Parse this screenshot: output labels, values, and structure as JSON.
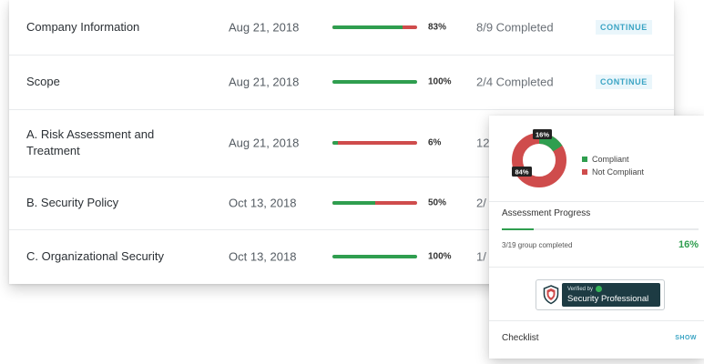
{
  "colors": {
    "complete_green": "#2f9e4f",
    "incomplete_red": "#cf4c4c",
    "continue_blue": "#3aa4c4",
    "badge_dark": "#1d3b43"
  },
  "table": {
    "rows": [
      {
        "name": "Company Information",
        "date": "Aug 21, 2018",
        "progress": 0.83,
        "pct": "83%",
        "completed": "8/9 Completed",
        "action": "CONTINUE"
      },
      {
        "name": "Scope",
        "date": "Aug 21, 2018",
        "progress": 1.0,
        "pct": "100%",
        "completed": "2/4 Completed",
        "action": "CONTINUE"
      },
      {
        "name": "A. Risk Assessment and Treatment",
        "date": "Aug 21, 2018",
        "progress": 0.06,
        "pct": "6%",
        "completed": "12",
        "action": ""
      },
      {
        "name": "B. Security Policy",
        "date": "Oct 13, 2018",
        "progress": 0.5,
        "pct": "50%",
        "completed": "2/",
        "action": ""
      },
      {
        "name": "C. Organizational Security",
        "date": "Oct 13, 2018",
        "progress": 1.0,
        "pct": "100%",
        "completed": "1/",
        "action": ""
      }
    ]
  },
  "panel": {
    "donut": {
      "compliant_fraction": 0.16,
      "compliant_label": "16%",
      "not_compliant_label": "84%"
    },
    "legend": {
      "compliant": "Compliant",
      "not_compliant": "Not Compliant"
    },
    "assessment_progress": {
      "title": "Assessment Progress",
      "progress": 0.16,
      "group_text": "3/19 group completed",
      "percent": "16%"
    },
    "badge": {
      "small_text": "Verified by",
      "big_text": "Security Professional",
      "shield_icon": "shield-icon",
      "check_icon": "check-circle-icon"
    },
    "checklist": {
      "label": "Checklist",
      "show_label": "SHOW"
    }
  }
}
